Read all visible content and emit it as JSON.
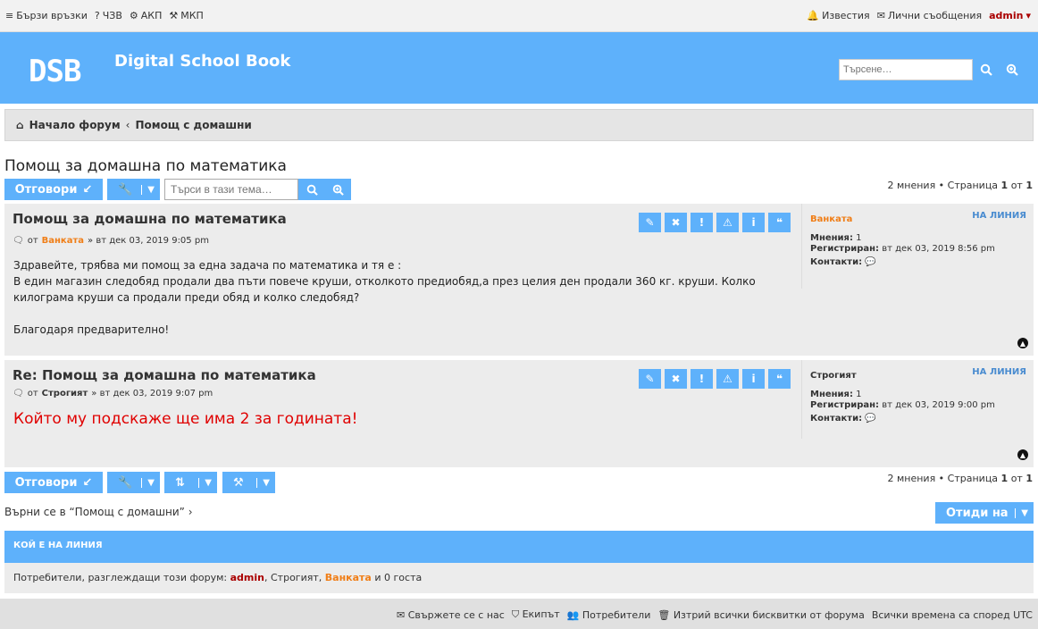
{
  "topbar": {
    "quick_links": "Бързи връзки",
    "faq": "ЧЗВ",
    "acp": "АКП",
    "mcp": "МКП",
    "notifications": "Известия",
    "messages": "Лични съобщения",
    "user": "admin"
  },
  "header": {
    "logo": "DSB",
    "site_name": "Digital School Book",
    "search_placeholder": "Търсене…"
  },
  "breadcrumb": {
    "home": "Начало форум",
    "separator": "‹",
    "forum": "Помощ с домашни"
  },
  "topic": {
    "title": "Помощ за домашна по математика",
    "reply_button": "Отговори",
    "search_placeholder": "Търси в тази тема…",
    "pagination_prefix": "2 мнения • Страница",
    "page": "1",
    "of": "от",
    "total_pages": "1"
  },
  "posts": [
    {
      "title": "Помощ за домашна по математика",
      "from": "от",
      "author": "Ванката",
      "date": "» вт дек 03, 2019 9:05 pm",
      "body": [
        "Здравейте, трябва ми помощ за една задача по математика и тя е :",
        "В един магазин следобяд продали два пъти повече круши, отколкото предиобяд,а през целия ден продали 360 кг. круши. Колко килограма круши са продали преди обяд и колко следобяд?",
        "",
        "Благодаря предварително!"
      ],
      "status": "НА ЛИНИЯ",
      "posts_label": "Мнения:",
      "posts_count": "1",
      "registered_label": "Регистриран:",
      "registered": "вт дек 03, 2019 8:56 pm",
      "contacts_label": "Контакти:"
    },
    {
      "title": "Re: Помощ за домашна по математика",
      "from": "от",
      "author": "Строгият",
      "date": "» вт дек 03, 2019 9:07 pm",
      "body_highlight": "Който му подскаже ще има 2 за годината!",
      "status": "НА ЛИНИЯ",
      "posts_label": "Мнения:",
      "posts_count": "1",
      "registered_label": "Регистриран:",
      "registered": "вт дек 03, 2019 9:00 pm",
      "contacts_label": "Контакти:"
    }
  ],
  "bottom": {
    "jump_back": "Върни се в “Помощ с домашни”",
    "goto": "Отиди на"
  },
  "whos_online": {
    "title": "КОЙ Е НА ЛИНИЯ",
    "prefix": "Потребители, разглеждащи този форум:",
    "user1": "admin",
    "user2": "Строгият",
    "user3": "Ванката",
    "suffix": "и 0 госта"
  },
  "footer": {
    "contact": "Свържете се с нас",
    "team": "Екипът",
    "members": "Потребители",
    "cookies": "Изтрий всички бисквитки от форума",
    "timezone": "Всички времена са според UTC"
  },
  "colors": {
    "accent": "#5eb1fb",
    "author_orange": "#f07e17",
    "admin_red": "#aa0000",
    "highlight_red": "#e00000"
  }
}
